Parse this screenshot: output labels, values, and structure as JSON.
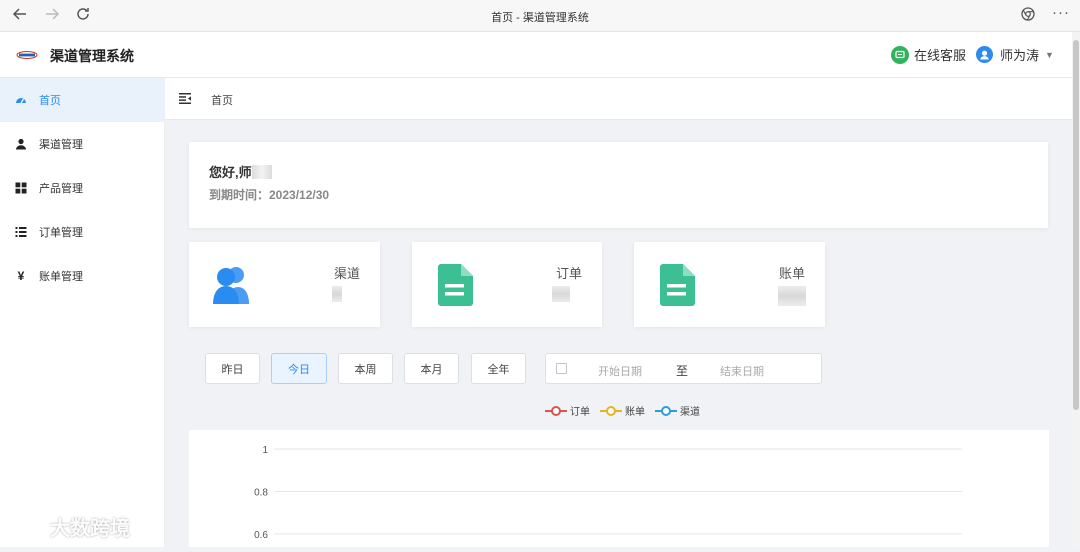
{
  "browser": {
    "tab_title": "首页 - 渠道管理系统",
    "back_icon": "arrow-left-icon",
    "forward_icon": "arrow-right-icon",
    "reload_icon": "reload-icon",
    "extension_icon": "browser-extension-icon",
    "more_label": "···"
  },
  "header": {
    "app_title": "渠道管理系统",
    "service_label": "在线客服",
    "user_name": "师为涛"
  },
  "sidebar": {
    "items": [
      {
        "label": "首页",
        "icon": "dashboard-icon",
        "active": true
      },
      {
        "label": "渠道管理",
        "icon": "user-icon"
      },
      {
        "label": "产品管理",
        "icon": "grid-icon"
      },
      {
        "label": "订单管理",
        "icon": "list-icon"
      },
      {
        "label": "账单管理",
        "icon": "yen-icon"
      }
    ]
  },
  "breadcrumb": {
    "current": "首页"
  },
  "welcome": {
    "greeting": "您好,师",
    "expire": "到期时间：2023/12/30"
  },
  "stats": [
    {
      "label": "渠道",
      "icon": "users-icon",
      "color": "#2a8cf0"
    },
    {
      "label": "订单",
      "icon": "document-icon",
      "color": "#3dbf94"
    },
    {
      "label": "账单",
      "icon": "document-icon",
      "color": "#3dbf94"
    }
  ],
  "filters": {
    "buttons": [
      "昨日",
      "今日",
      "本周",
      "本月",
      "全年"
    ],
    "active": "今日",
    "start_placeholder": "开始日期",
    "separator": "至",
    "end_placeholder": "结束日期"
  },
  "chart_data": {
    "type": "line",
    "series": [
      {
        "name": "订单",
        "color": "#d9534f",
        "values": []
      },
      {
        "name": "账单",
        "color": "#e6b422",
        "values": []
      },
      {
        "name": "渠道",
        "color": "#2a9fd6",
        "values": []
      }
    ],
    "y_ticks": [
      "1",
      "0.8",
      "0.6"
    ],
    "grid": true,
    "legend_position": "top-center"
  },
  "watermark": {
    "text": "大数跨境"
  }
}
